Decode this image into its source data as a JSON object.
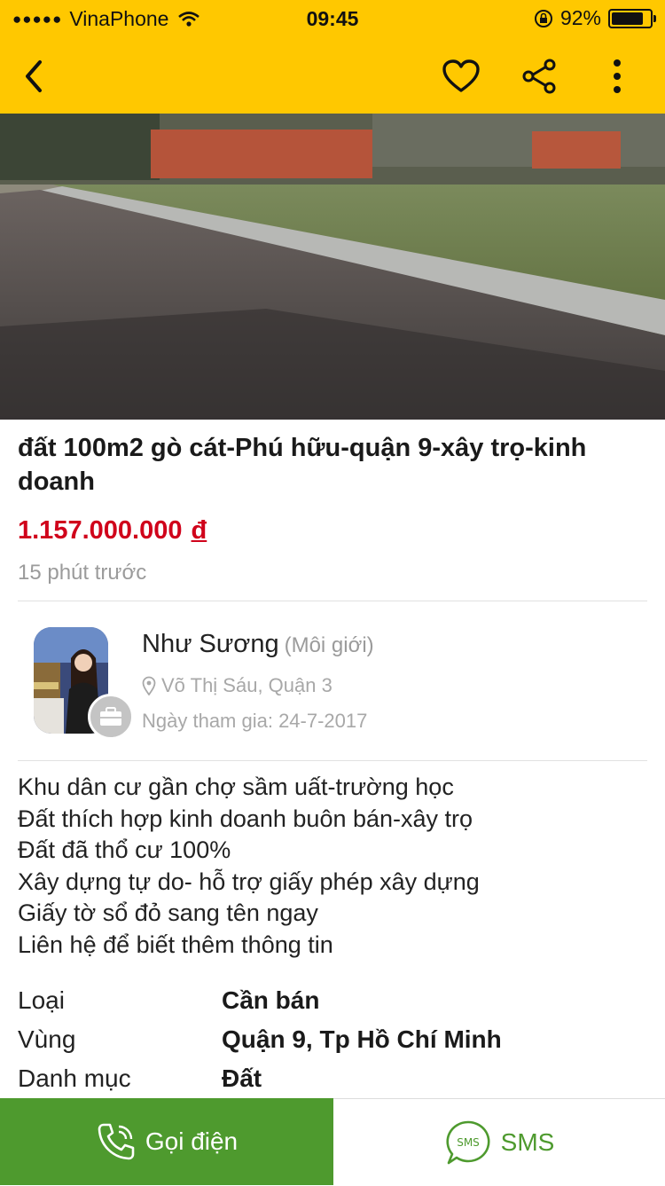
{
  "status_bar": {
    "carrier": "VinaPhone",
    "time": "09:45",
    "battery": "92%",
    "battery_level": 0.92
  },
  "nav": {
    "back_icon": "chevron-left-icon",
    "favorite_icon": "heart-icon",
    "share_icon": "share-icon",
    "more_icon": "more-vertical-icon"
  },
  "listing": {
    "title": "đất 100m2 gò cát-Phú hữu-quận 9-xây trọ-kinh doanh",
    "price": "1.157.000.000",
    "currency": "đ",
    "time_ago": "15 phút trước"
  },
  "seller": {
    "name": "Như Sương",
    "role": "(Môi giới)",
    "location": "Võ Thị Sáu, Quận 3",
    "joined": "Ngày tham gia: 24-7-2017"
  },
  "description": [
    "Khu dân cư gần chợ sầm uất-trường học",
    "Đất thích hợp kinh doanh buôn bán-xây trọ",
    "Đất đã thổ cư 100%",
    "Xây dựng tự do- hỗ trợ giấy phép xây dựng",
    "Giấy tờ sổ đỏ sang tên ngay",
    "Liên hệ để biết thêm thông tin"
  ],
  "details": [
    {
      "key": "Loại",
      "value": "Cần bán"
    },
    {
      "key": "Vùng",
      "value": "Quận 9, Tp Hồ Chí Minh"
    },
    {
      "key": "Danh mục",
      "value": "Đất"
    }
  ],
  "actions": {
    "call_label": "Gọi điện",
    "sms_label": "SMS",
    "sms_icon_text": "SMS"
  },
  "colors": {
    "accent": "#ffc800",
    "price": "#d0021b",
    "call": "#4e9a2e"
  }
}
